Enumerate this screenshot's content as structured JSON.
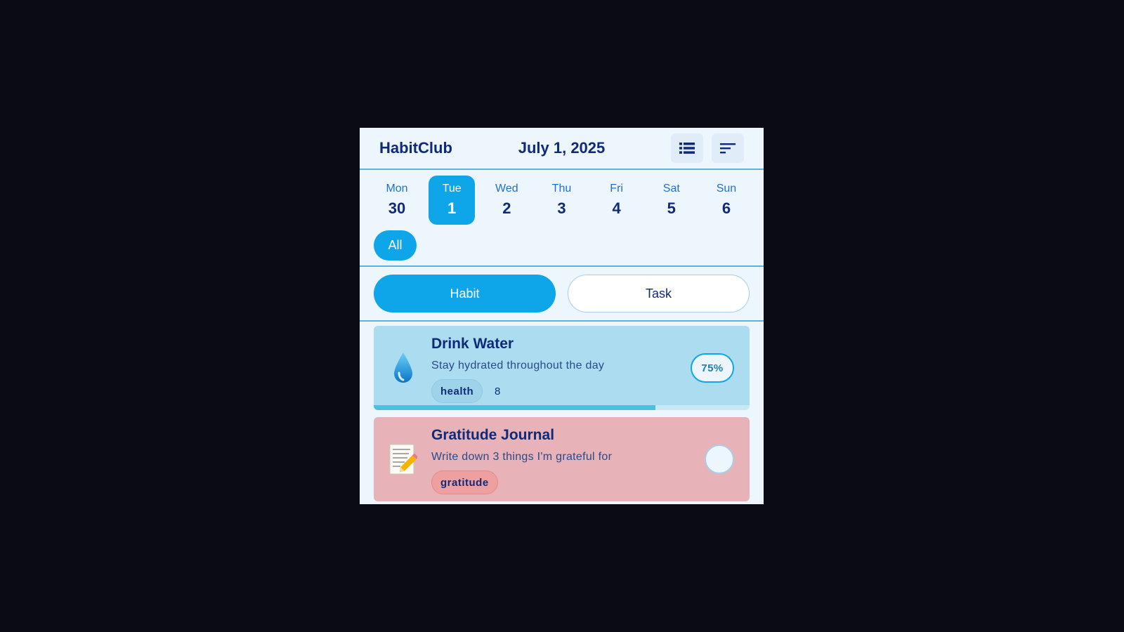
{
  "app": {
    "brand": "HabitClub",
    "date_title": "July 1, 2025"
  },
  "header": {
    "buttons": [
      {
        "name": "list-view-button",
        "icon": "list-icon"
      },
      {
        "name": "sort-button",
        "icon": "sort-icon"
      }
    ]
  },
  "week": [
    {
      "name": "Mon",
      "num": "30",
      "active": false
    },
    {
      "name": "Tue",
      "num": "1",
      "active": true
    },
    {
      "name": "Wed",
      "num": "2",
      "active": false
    },
    {
      "name": "Thu",
      "num": "3",
      "active": false
    },
    {
      "name": "Fri",
      "num": "4",
      "active": false
    },
    {
      "name": "Sat",
      "num": "5",
      "active": false
    },
    {
      "name": "Sun",
      "num": "6",
      "active": false
    }
  ],
  "filter": {
    "all_label": "All"
  },
  "toggle": {
    "habit_label": "Habit",
    "task_label": "Task",
    "selected": "Habit"
  },
  "colors": {
    "accent": "#0ea5e9",
    "card_blue": "#abdcef",
    "card_pink": "#e7b3b8",
    "tag_blue": "#9fd3ea",
    "tag_pink": "#ee9f9f",
    "progress_fill": "#4fbfe0"
  },
  "habits": [
    {
      "icon": "water-drop-icon",
      "title": "Drink Water",
      "description": "Stay hydrated throughout the day",
      "tag": "health",
      "count": "8",
      "progress_label": "75%",
      "progress": 0.75,
      "color": "blue"
    },
    {
      "icon": "notepad-pencil-icon",
      "title": "Gratitude Journal",
      "description": "Write down 3 things I'm grateful for",
      "tag": "gratitude",
      "count": "",
      "progress_label": "",
      "progress": 0,
      "color": "pink"
    }
  ]
}
